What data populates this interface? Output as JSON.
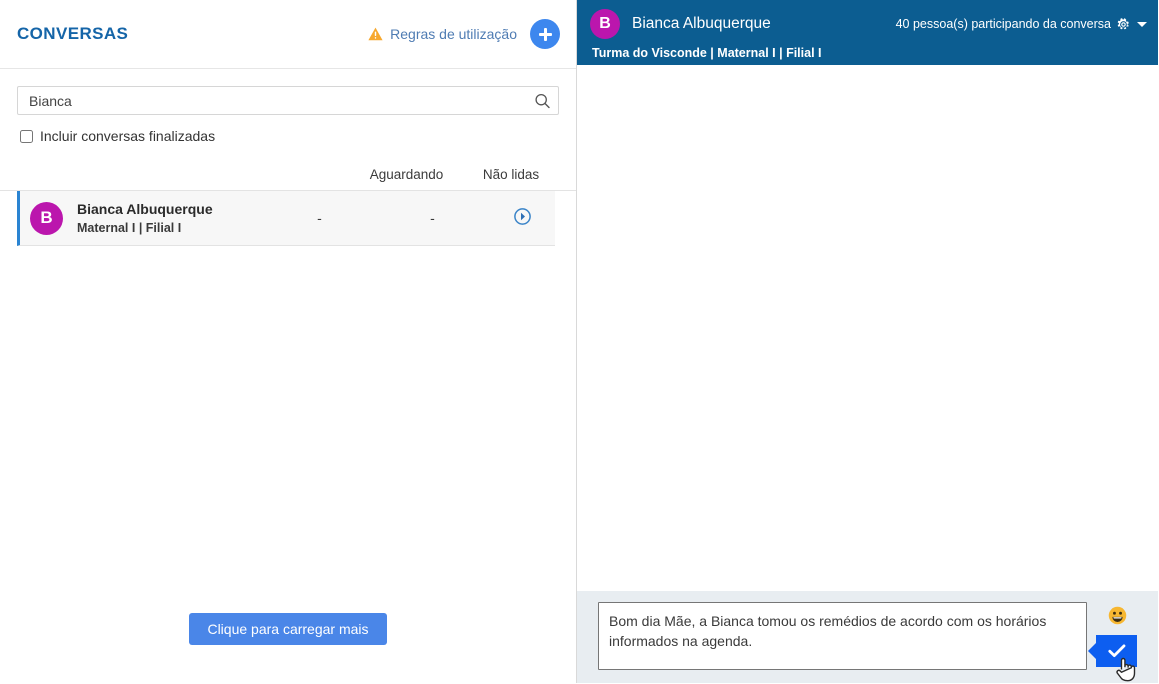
{
  "left_panel": {
    "title": "CONVERSAS",
    "rules_link": {
      "label": "Regras de utilização",
      "icon": "warning-triangle-icon"
    },
    "add_button": {
      "icon": "plus-icon",
      "label": "+"
    },
    "search": {
      "value": "Bianca",
      "placeholder": "Bianca",
      "icon": "search-icon"
    },
    "include_finished": {
      "label": "Incluir conversas finalizadas",
      "checked": false
    },
    "table": {
      "columns": [
        "",
        "Aguardando",
        "Não lidas"
      ],
      "rows": [
        {
          "avatar_letter": "B",
          "avatar_color": "#bb16ad",
          "name": "Bianca Albuquerque",
          "subtitle": "Maternal I | Filial I",
          "aguardando": "-",
          "nao_lidas": "-",
          "action_icon": "chevron-right-circle-icon",
          "selected": true
        }
      ]
    },
    "load_more_label": "Clique para carregar mais"
  },
  "chat": {
    "header": {
      "avatar_letter": "B",
      "avatar_color": "#bb16ad",
      "background_color": "#0c5d91",
      "name": "Bianca Albuquerque",
      "participants_text": "40 pessoa(s) participando da conversa",
      "participants_icons": [
        "gear-icon",
        "caret-down-icon"
      ],
      "breadcrumb": "Turma do Visconde | Maternal I | Filial I"
    },
    "messages": [],
    "composer": {
      "message": "Bom dia Mãe, a Bianca tomou os remédios de acordo com os horários informados na agenda.",
      "placeholder": "",
      "emoji_icon": "grinning-face-icon",
      "send_icon": "check-icon",
      "send_color": "#0d5ef0"
    }
  },
  "theme": {
    "accent_blue": "#1565a8",
    "link_blue": "#4f7cb3",
    "button_blue": "#4a86e8",
    "add_blue": "#3d87ee",
    "header_blue": "#0c5d91",
    "avatar_magenta": "#bb16ad",
    "warning_orange": "#f7a82e",
    "composer_bg": "#e8edf1"
  }
}
